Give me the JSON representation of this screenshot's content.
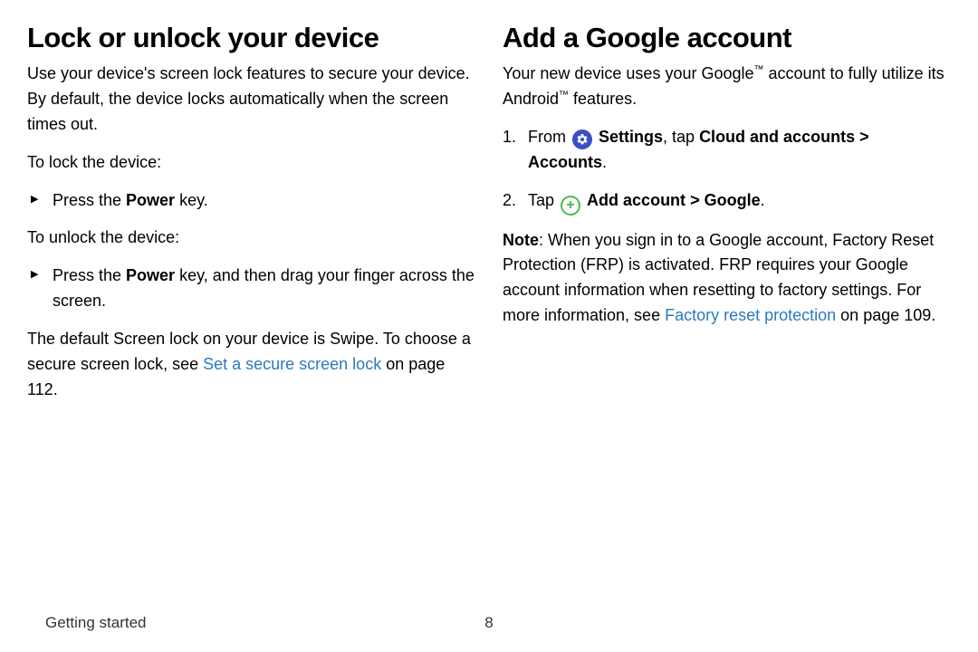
{
  "left": {
    "heading": "Lock or unlock your device",
    "intro": "Use your device's screen lock features to secure your device. By default, the device locks automatically when the screen times out.",
    "lock_label": "To lock the device:",
    "lock_bullet_pre": "Press the ",
    "lock_bullet_bold": "Power",
    "lock_bullet_post": " key.",
    "unlock_label": "To unlock the device:",
    "unlock_bullet_pre": "Press the ",
    "unlock_bullet_bold": "Power",
    "unlock_bullet_post": " key, and then drag your finger across the screen.",
    "outro_pre": "The default Screen lock on your device is Swipe. To choose a secure screen lock, see ",
    "outro_link": "Set a secure screen lock",
    "outro_post": " on page 112."
  },
  "right": {
    "heading": "Add a Google account",
    "intro_pre": "Your new device uses your Google",
    "intro_mid": " account to fully utilize its Android",
    "intro_post": " features.",
    "step1_pre": "From ",
    "step1_settings": "Settings",
    "step1_mid": ", tap ",
    "step1_cloud": "Cloud and accounts",
    "step1_sep": " > ",
    "step1_accounts": "Accounts",
    "step1_end": ".",
    "step2_pre": "Tap ",
    "step2_add": "Add account",
    "step2_sep": " > ",
    "step2_google": "Google",
    "step2_end": ".",
    "note_bold": "Note",
    "note_pre": ": When you sign in to a Google account, Factory Reset Protection (FRP) is activated. FRP requires your Google account information when resetting to factory settings. For more information, see ",
    "note_link": "Factory reset protection",
    "note_post": " on page 109."
  },
  "footer": {
    "section": "Getting started",
    "page": "8"
  },
  "ord": {
    "one": "1.",
    "two": "2."
  },
  "tm": "™"
}
